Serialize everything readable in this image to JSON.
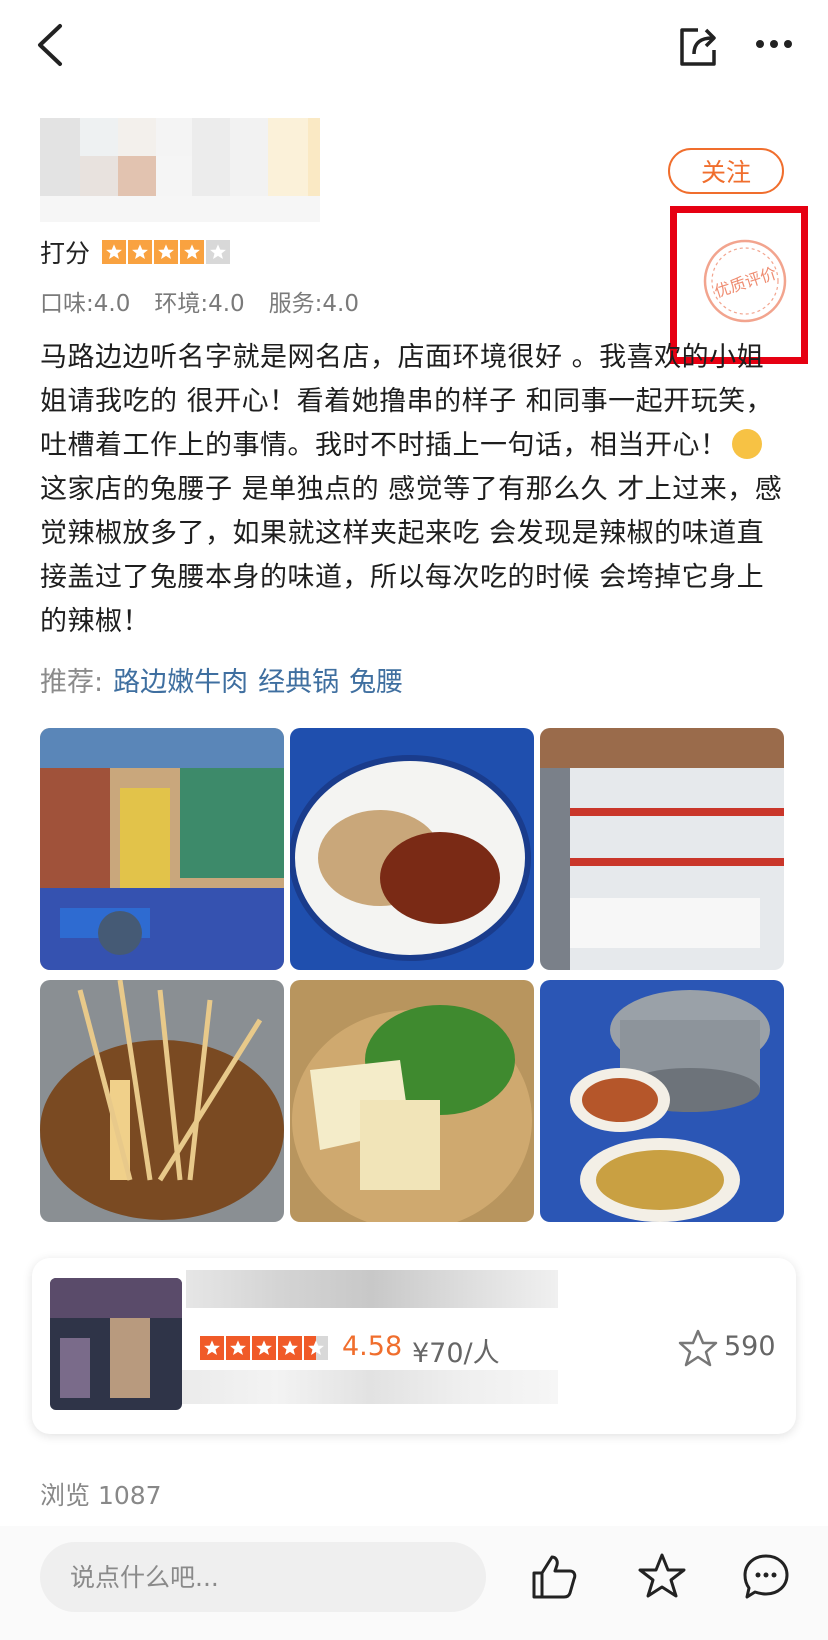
{
  "topbar": {
    "back_icon": "back-arrow-icon",
    "share_icon": "share-icon",
    "more_icon": "more-dots-icon"
  },
  "header": {
    "follow_label": "关注",
    "stamp_text": "优质评价"
  },
  "rating": {
    "label": "打分",
    "stars": 4,
    "max": 5
  },
  "subscores": [
    "口味:4.0",
    "环境:4.0",
    "服务:4.0"
  ],
  "review": {
    "text_before_emoji": "马路边边听名字就是网名店，店面环境很好 。我喜欢的小姐姐请我吃的 很开心！看着她撸串的样子 和同事一起开玩笑，吐槽着工作上的事情。我时不时插上一句话，相当开心！",
    "text_after_emoji": "这家店的兔腰子 是单独点的 感觉等了有那么久 才上过来，感觉辣椒放多了，如果就这样夹起来吃 会发现是辣椒的味道直接盖过了兔腰本身的味道，所以每次吃的时候 会垮掉它身上的辣椒！"
  },
  "recommend": {
    "label": "推荐:",
    "items": [
      "路边嫩牛肉",
      "经典锅",
      "兔腰"
    ]
  },
  "shop": {
    "rating_stars": 4.5,
    "score": "4.58",
    "price": "¥70/人",
    "fav_count": "590"
  },
  "views": "浏览 1087",
  "bottom": {
    "comment_placeholder": "说点什么吧..."
  },
  "colors": {
    "accent": "#f06e2d",
    "star": "#f9a240",
    "highlight_box": "#e60012",
    "link": "#3f6fa0"
  }
}
